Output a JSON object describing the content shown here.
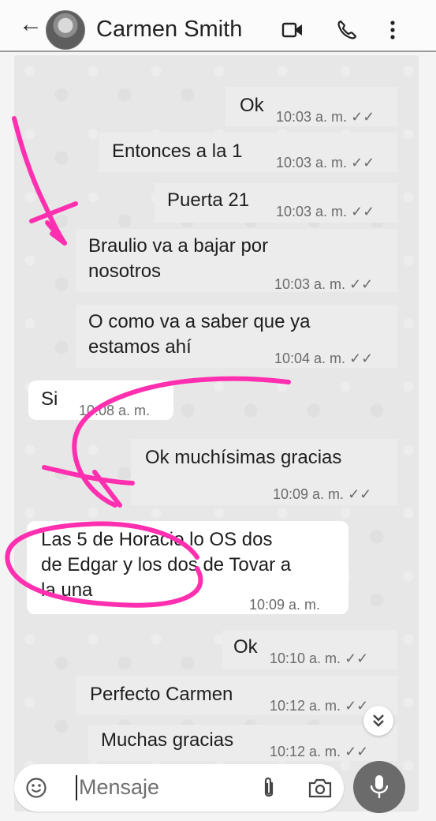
{
  "header": {
    "back_icon": "arrow-left-icon",
    "contact_name": "Carmen Smith",
    "video_icon": "video-call-icon",
    "call_icon": "phone-icon",
    "menu_icon": "more-vert-icon"
  },
  "messages": [
    {
      "dir": "out",
      "lines": [
        "Ok"
      ],
      "time": "10:03 a. m.",
      "status": "read"
    },
    {
      "dir": "out",
      "lines": [
        "Entonces a la 1"
      ],
      "time": "10:03 a. m.",
      "status": "read"
    },
    {
      "dir": "out",
      "lines": [
        "Puerta 21"
      ],
      "time": "10:03 a. m.",
      "status": "read"
    },
    {
      "dir": "out",
      "lines": [
        "Braulio va a bajar por",
        "nosotros"
      ],
      "time": "10:03 a. m.",
      "status": "read"
    },
    {
      "dir": "out",
      "lines": [
        "O como va a saber que ya",
        "estamos ahí"
      ],
      "time": "10:04 a. m.",
      "status": "read"
    },
    {
      "dir": "in",
      "lines": [
        "Si"
      ],
      "time": "10:08 a. m."
    },
    {
      "dir": "out",
      "lines": [
        "Ok muchísimas gracias"
      ],
      "time": "10:09 a. m.",
      "status": "read"
    },
    {
      "dir": "in",
      "lines": [
        "Las 5 de Horacio lo OS dos",
        "de Edgar y los dos de Tovar a",
        "la una"
      ],
      "time": "10:09 a. m."
    },
    {
      "dir": "out",
      "lines": [
        "Ok"
      ],
      "time": "10:10 a. m.",
      "status": "read"
    },
    {
      "dir": "out",
      "lines": [
        "Perfecto Carmen"
      ],
      "time": "10:12 a. m.",
      "status": "read"
    },
    {
      "dir": "out",
      "lines": [
        "Muchas gracias"
      ],
      "time": "10:12 a. m.",
      "status": "read"
    }
  ],
  "tick_glyph": "✓✓",
  "compose": {
    "emoji_icon": "emoji-icon",
    "placeholder": "Mensaje",
    "attach_icon": "paperclip-icon",
    "camera_icon": "camera-icon",
    "mic_icon": "microphone-icon"
  },
  "scroll_down_icon": "double-chevron-down-icon",
  "annotation_color": "#ff2fb0"
}
